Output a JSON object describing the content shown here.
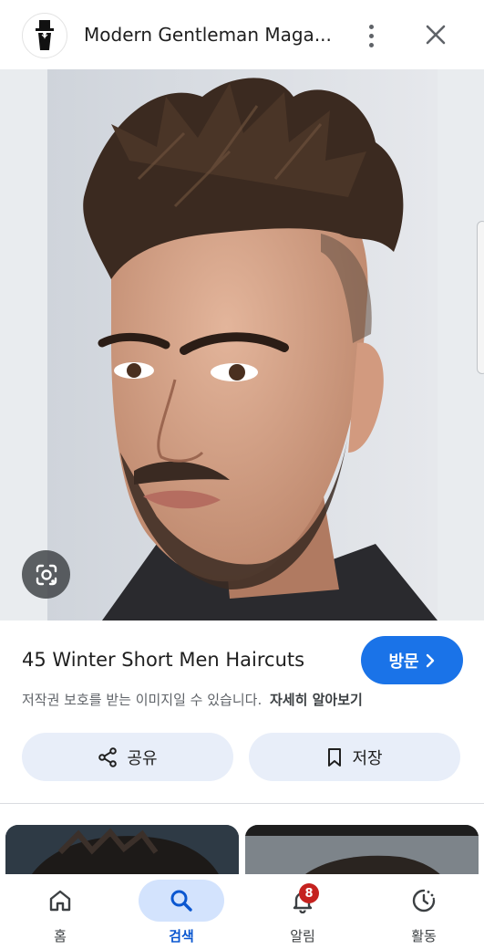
{
  "header": {
    "site_title": "Modern Gentleman Maga...",
    "logo_icon": "top-hat-gentleman-icon",
    "more_icon": "more-vertical-icon",
    "close_icon": "close-icon"
  },
  "image": {
    "subject": "photo",
    "lens_icon": "google-lens-icon"
  },
  "result": {
    "title": "45 Winter Short Men Haircuts",
    "visit_label": "방문",
    "copyright_note": "저작권 보호를 받는 이미지일 수 있습니다.",
    "learn_more": "자세히 알아보기"
  },
  "actions": {
    "share_label": "공유",
    "save_label": "저장"
  },
  "bottom_nav": {
    "items": [
      {
        "label": "홈",
        "icon": "home-icon"
      },
      {
        "label": "검색",
        "icon": "search-icon",
        "active": true
      },
      {
        "label": "알림",
        "icon": "bell-icon",
        "badge": "8"
      },
      {
        "label": "활동",
        "icon": "activity-history-icon"
      }
    ]
  },
  "colors": {
    "accent": "#1a73e8",
    "chip_bg": "#e8eef9",
    "active_nav_bg": "#d3e3fd",
    "badge": "#c5221f"
  }
}
